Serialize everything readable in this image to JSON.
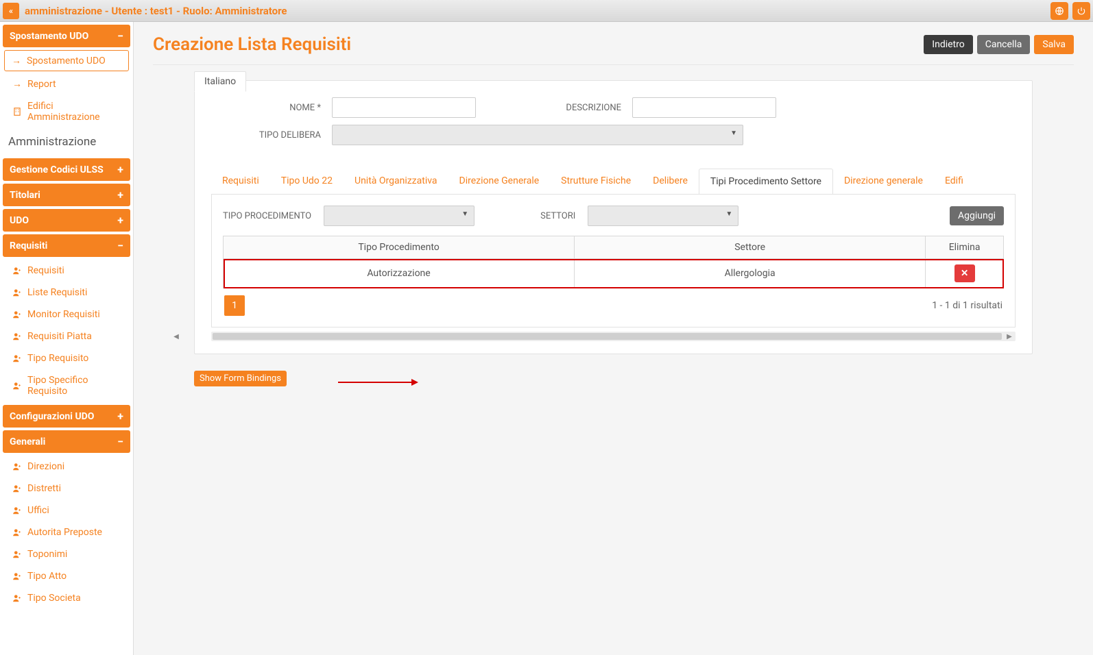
{
  "topbar": {
    "title": "amministrazione - Utente : test1 - Ruolo: Amministratore"
  },
  "sidebar": {
    "groups": [
      {
        "label": "Spostamento UDO",
        "expand": "−",
        "items": [
          {
            "icon": "arrow",
            "label": "Spostamento UDO",
            "active": true
          }
        ]
      },
      {
        "plain_items": [
          {
            "icon": "arrow",
            "label": "Report"
          },
          {
            "icon": "building",
            "label": "Edifici Amministrazione"
          }
        ]
      },
      {
        "section_title": "Amministrazione"
      },
      {
        "label": "Gestione Codici ULSS",
        "expand": "+"
      },
      {
        "label": "Titolari",
        "expand": "+"
      },
      {
        "label": "UDO",
        "expand": "+"
      },
      {
        "label": "Requisiti",
        "expand": "−",
        "items": [
          {
            "icon": "person",
            "label": "Requisiti"
          },
          {
            "icon": "person",
            "label": "Liste Requisiti"
          },
          {
            "icon": "person",
            "label": "Monitor Requisiti"
          },
          {
            "icon": "person",
            "label": "Requisiti Piatta"
          },
          {
            "icon": "person",
            "label": "Tipo Requisito"
          },
          {
            "icon": "person",
            "label": "Tipo Specifico Requisito"
          }
        ]
      },
      {
        "label": "Configurazioni UDO",
        "expand": "+"
      },
      {
        "label": "Generali",
        "expand": "−",
        "items": [
          {
            "icon": "person",
            "label": "Direzioni"
          },
          {
            "icon": "person",
            "label": "Distretti"
          },
          {
            "icon": "person",
            "label": "Uffici"
          },
          {
            "icon": "person",
            "label": "Autorita Preposte"
          },
          {
            "icon": "person",
            "label": "Toponimi"
          },
          {
            "icon": "person",
            "label": "Tipo Atto"
          },
          {
            "icon": "person",
            "label": "Tipo Societa"
          }
        ]
      }
    ]
  },
  "page": {
    "title": "Creazione Lista Requisiti",
    "btn_back": "Indietro",
    "btn_cancel": "Cancella",
    "btn_save": "Salva"
  },
  "form": {
    "lang_tab": "Italiano",
    "nome_label": "NOME *",
    "descr_label": "DESCRIZIONE",
    "tipo_delibera_label": "TIPO DELIBERA"
  },
  "tabs": {
    "items": [
      "Requisiti",
      "Tipo Udo 22",
      "Unità Organizzativa",
      "Direzione Generale",
      "Strutture Fisiche",
      "Delibere",
      "Tipi Procedimento Settore",
      "Direzione generale",
      "Edifi"
    ],
    "active_index": 6
  },
  "filter": {
    "tipo_proc_label": "TIPO PROCEDIMENTO",
    "settori_label": "SETTORI",
    "add_btn": "Aggiungi"
  },
  "table": {
    "headers": {
      "proc": "Tipo Procedimento",
      "sector": "Settore",
      "del": "Elimina"
    },
    "rows": [
      {
        "proc": "Autorizzazione",
        "sector": "Allergologia"
      }
    ]
  },
  "pager": {
    "page": "1",
    "results": "1 - 1 di 1 risultati"
  },
  "footer": {
    "show_bindings": "Show Form Bindings"
  }
}
